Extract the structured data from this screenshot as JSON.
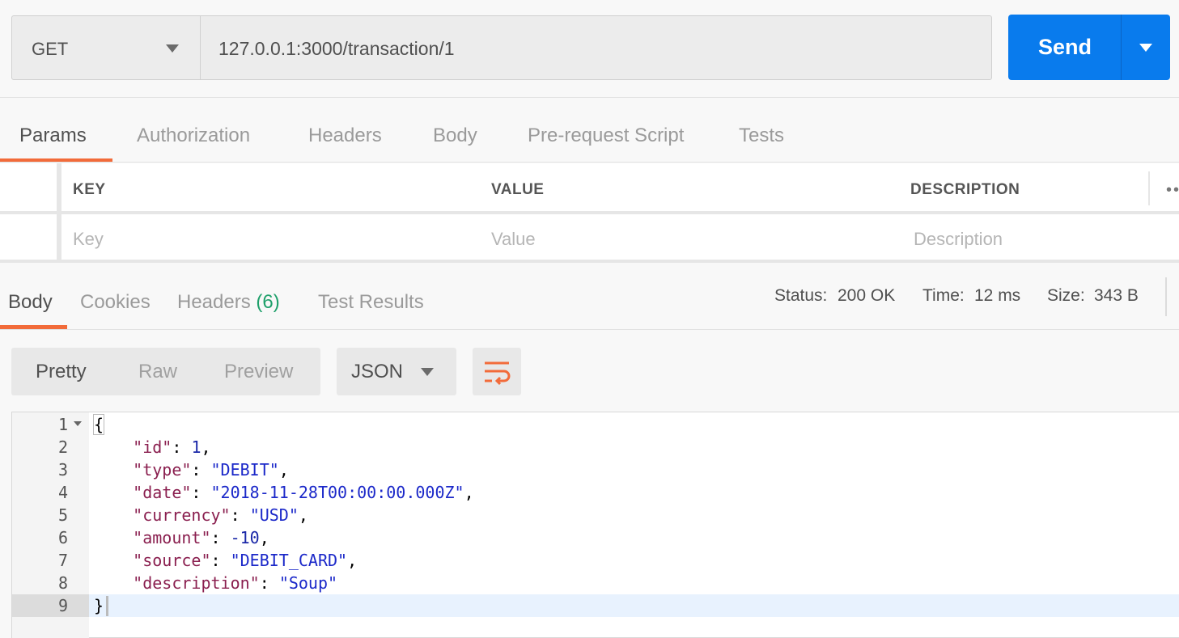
{
  "request": {
    "method": "GET",
    "url": "127.0.0.1:3000/transaction/1",
    "send_label": "Send"
  },
  "request_tabs": [
    "Params",
    "Authorization",
    "Headers",
    "Body",
    "Pre-request Script",
    "Tests"
  ],
  "params_table": {
    "columns": [
      "KEY",
      "VALUE",
      "DESCRIPTION"
    ],
    "placeholders": {
      "key": "Key",
      "value": "Value",
      "description": "Description"
    }
  },
  "response_tabs": {
    "body": "Body",
    "cookies": "Cookies",
    "headers": "Headers",
    "headers_count": "(6)",
    "test_results": "Test Results"
  },
  "status": {
    "status_label": "Status:",
    "status_value": "200 OK",
    "time_label": "Time:",
    "time_value": "12 ms",
    "size_label": "Size:",
    "size_value": "343 B"
  },
  "view_modes": [
    "Pretty",
    "Raw",
    "Preview"
  ],
  "format": "JSON",
  "colors": {
    "accent": "#097bed",
    "tab_underline": "#f26b3a",
    "status_green": "#1fa06b"
  },
  "response_body": {
    "line_numbers": [
      "1",
      "2",
      "3",
      "4",
      "5",
      "6",
      "7",
      "8",
      "9"
    ],
    "open_brace": "{",
    "close_brace": "}",
    "fields": [
      {
        "key": "\"id\"",
        "value": "1",
        "kind": "num",
        "comma": ","
      },
      {
        "key": "\"type\"",
        "value": "\"DEBIT\"",
        "kind": "str",
        "comma": ","
      },
      {
        "key": "\"date\"",
        "value": "\"2018-11-28T00:00:00.000Z\"",
        "kind": "str",
        "comma": ","
      },
      {
        "key": "\"currency\"",
        "value": "\"USD\"",
        "kind": "str",
        "comma": ","
      },
      {
        "key": "\"amount\"",
        "value": "-10",
        "kind": "num",
        "comma": ","
      },
      {
        "key": "\"source\"",
        "value": "\"DEBIT_CARD\"",
        "kind": "str",
        "comma": ","
      },
      {
        "key": "\"description\"",
        "value": "\"Soup\"",
        "kind": "str",
        "comma": ""
      }
    ]
  }
}
